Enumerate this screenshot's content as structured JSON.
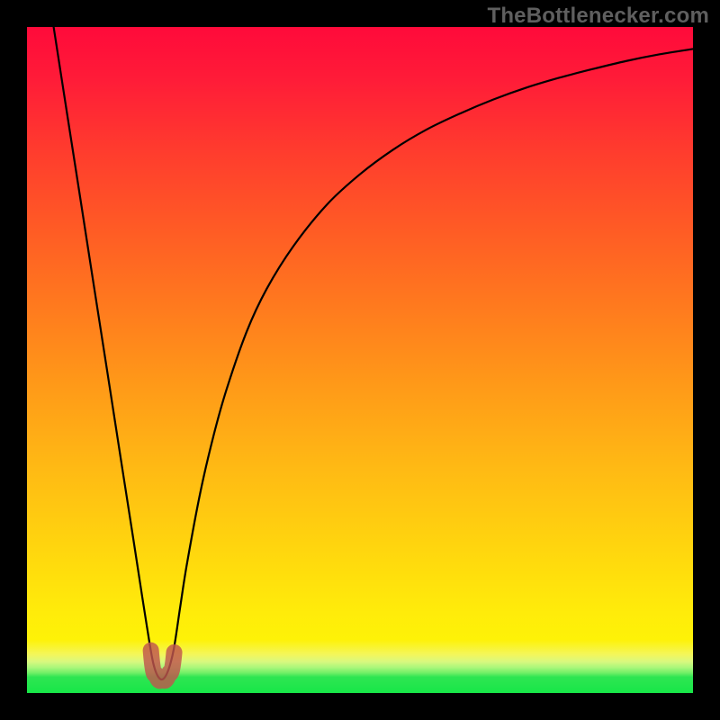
{
  "watermark": {
    "text": "TheBottlenecker.com"
  },
  "colors": {
    "page_bg": "#000000",
    "gradient_top": "#ff0a3a",
    "gradient_mid1": "#ff7a1e",
    "gradient_mid2": "#ffd50e",
    "gradient_low": "#fef207",
    "gradient_band": "#d8f87f",
    "gradient_bottom": "#17e748",
    "curve_stroke": "#000000",
    "marker_stroke": "#c0554d"
  },
  "chart_data": {
    "type": "line",
    "title": "",
    "xlabel": "",
    "ylabel": "",
    "xlim": [
      0,
      100
    ],
    "ylim": [
      0,
      100
    ],
    "grid": false,
    "legend": false,
    "x": [
      4,
      6,
      8,
      10,
      12,
      14,
      16,
      17,
      18,
      19,
      20,
      21,
      22,
      23,
      24,
      26,
      28,
      30,
      33,
      36,
      40,
      45,
      50,
      55,
      60,
      65,
      70,
      75,
      80,
      85,
      90,
      95,
      100
    ],
    "series": [
      {
        "name": "bottleneck-curve",
        "values": [
          100,
          87.1,
          74.3,
          61.4,
          48.6,
          35.7,
          22.9,
          16.4,
          10.0,
          4.3,
          2.1,
          2.9,
          6.4,
          12.9,
          19.3,
          30.0,
          38.6,
          45.7,
          54.3,
          60.7,
          67.1,
          73.3,
          77.9,
          81.6,
          84.6,
          87.0,
          89.1,
          90.9,
          92.4,
          93.7,
          94.9,
          95.9,
          96.7
        ]
      }
    ],
    "marker": {
      "name": "valley-marker",
      "points": [
        {
          "x": 18.6,
          "y": 6.4
        },
        {
          "x": 19.3,
          "y": 2.9
        },
        {
          "x": 20.3,
          "y": 2.1
        },
        {
          "x": 21.4,
          "y": 3.1
        },
        {
          "x": 22.1,
          "y": 6.1
        }
      ]
    }
  }
}
